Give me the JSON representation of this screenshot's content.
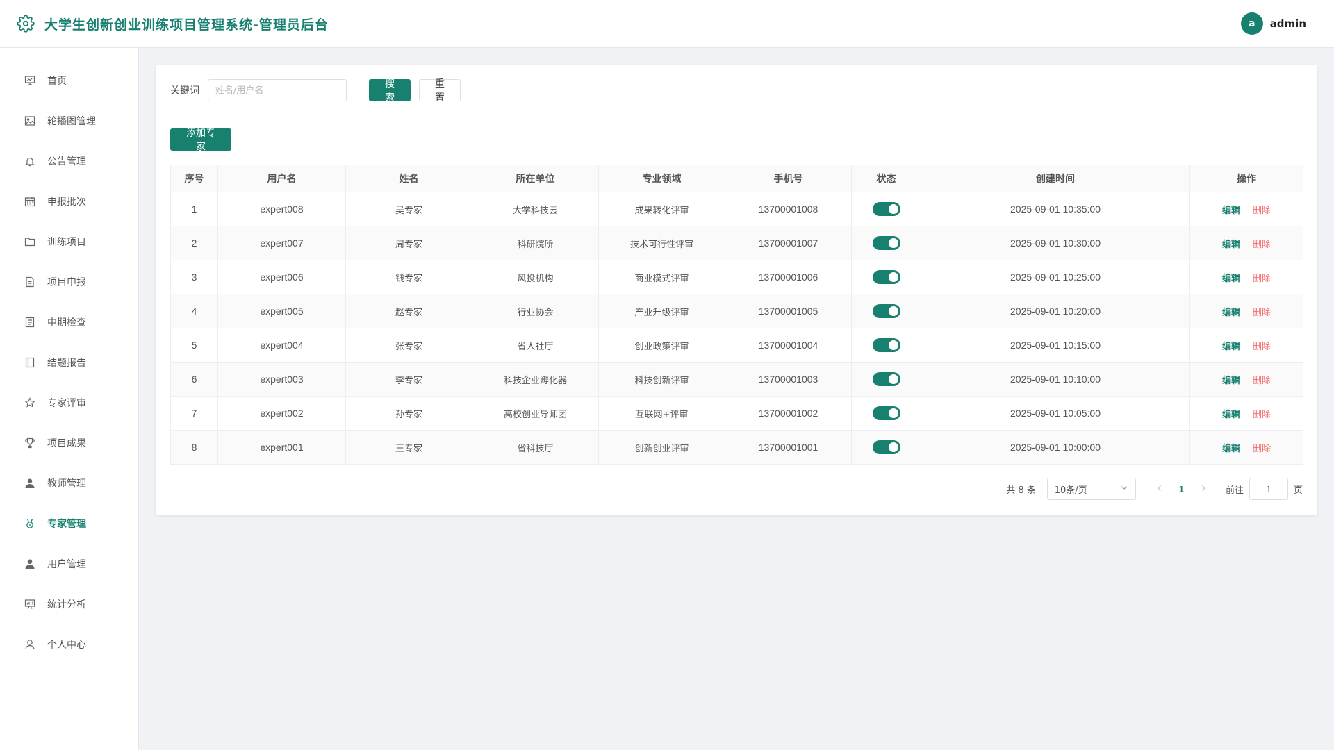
{
  "header": {
    "title": "大学生创新创业训练项目管理系统-管理员后台",
    "avatar_letter": "a",
    "username": "admin",
    "accent_color": "#17806f"
  },
  "sidebar": {
    "items": [
      {
        "label": "首页",
        "icon": "dashboard-icon",
        "active": false
      },
      {
        "label": "轮播图管理",
        "icon": "image-icon",
        "active": false
      },
      {
        "label": "公告管理",
        "icon": "bell-icon",
        "active": false
      },
      {
        "label": "申报批次",
        "icon": "calendar-icon",
        "active": false
      },
      {
        "label": "训练项目",
        "icon": "folder-icon",
        "active": false
      },
      {
        "label": "项目申报",
        "icon": "document-icon",
        "active": false
      },
      {
        "label": "中期检查",
        "icon": "checklist-icon",
        "active": false
      },
      {
        "label": "结题报告",
        "icon": "book-icon",
        "active": false
      },
      {
        "label": "专家评审",
        "icon": "star-icon",
        "active": false
      },
      {
        "label": "项目成果",
        "icon": "trophy-icon",
        "active": false
      },
      {
        "label": "教师管理",
        "icon": "user-filled-icon",
        "active": false
      },
      {
        "label": "专家管理",
        "icon": "medal-icon",
        "active": true
      },
      {
        "label": "用户管理",
        "icon": "user-filled-icon",
        "active": false
      },
      {
        "label": "统计分析",
        "icon": "chart-board-icon",
        "active": false
      },
      {
        "label": "个人中心",
        "icon": "user-outline-icon",
        "active": false
      }
    ]
  },
  "search": {
    "label": "关键词",
    "placeholder": "姓名/用户名",
    "value": "",
    "search_button": "搜索",
    "reset_button": "重置"
  },
  "toolbar": {
    "add_button": "添加专家"
  },
  "table": {
    "headers": [
      "序号",
      "用户名",
      "姓名",
      "所在单位",
      "专业领域",
      "手机号",
      "状态",
      "创建时间",
      "操作"
    ],
    "edit_label": "编辑",
    "delete_label": "删除",
    "rows": [
      {
        "index": "1",
        "username": "expert008",
        "name": "吴专家",
        "unit": "大学科技园",
        "field": "成果转化评审",
        "phone": "13700001008",
        "status_on": true,
        "created": "2025-09-01 10:35:00"
      },
      {
        "index": "2",
        "username": "expert007",
        "name": "周专家",
        "unit": "科研院所",
        "field": "技术可行性评审",
        "phone": "13700001007",
        "status_on": true,
        "created": "2025-09-01 10:30:00"
      },
      {
        "index": "3",
        "username": "expert006",
        "name": "钱专家",
        "unit": "风投机构",
        "field": "商业模式评审",
        "phone": "13700001006",
        "status_on": true,
        "created": "2025-09-01 10:25:00"
      },
      {
        "index": "4",
        "username": "expert005",
        "name": "赵专家",
        "unit": "行业协会",
        "field": "产业升级评审",
        "phone": "13700001005",
        "status_on": true,
        "created": "2025-09-01 10:20:00"
      },
      {
        "index": "5",
        "username": "expert004",
        "name": "张专家",
        "unit": "省人社厅",
        "field": "创业政策评审",
        "phone": "13700001004",
        "status_on": true,
        "created": "2025-09-01 10:15:00"
      },
      {
        "index": "6",
        "username": "expert003",
        "name": "李专家",
        "unit": "科技企业孵化器",
        "field": "科技创新评审",
        "phone": "13700001003",
        "status_on": true,
        "created": "2025-09-01 10:10:00"
      },
      {
        "index": "7",
        "username": "expert002",
        "name": "孙专家",
        "unit": "高校创业导师团",
        "field": "互联网+评审",
        "phone": "13700001002",
        "status_on": true,
        "created": "2025-09-01 10:05:00"
      },
      {
        "index": "8",
        "username": "expert001",
        "name": "王专家",
        "unit": "省科技厅",
        "field": "创新创业评审",
        "phone": "13700001001",
        "status_on": true,
        "created": "2025-09-01 10:00:00"
      }
    ]
  },
  "pagination": {
    "total_text": "共 8 条",
    "page_size": "10条/页",
    "current_page": "1",
    "goto_label": "前往",
    "goto_value": "1",
    "page_unit": "页",
    "prev_icon": "chevron-left-icon",
    "next_icon": "chevron-right-icon"
  }
}
